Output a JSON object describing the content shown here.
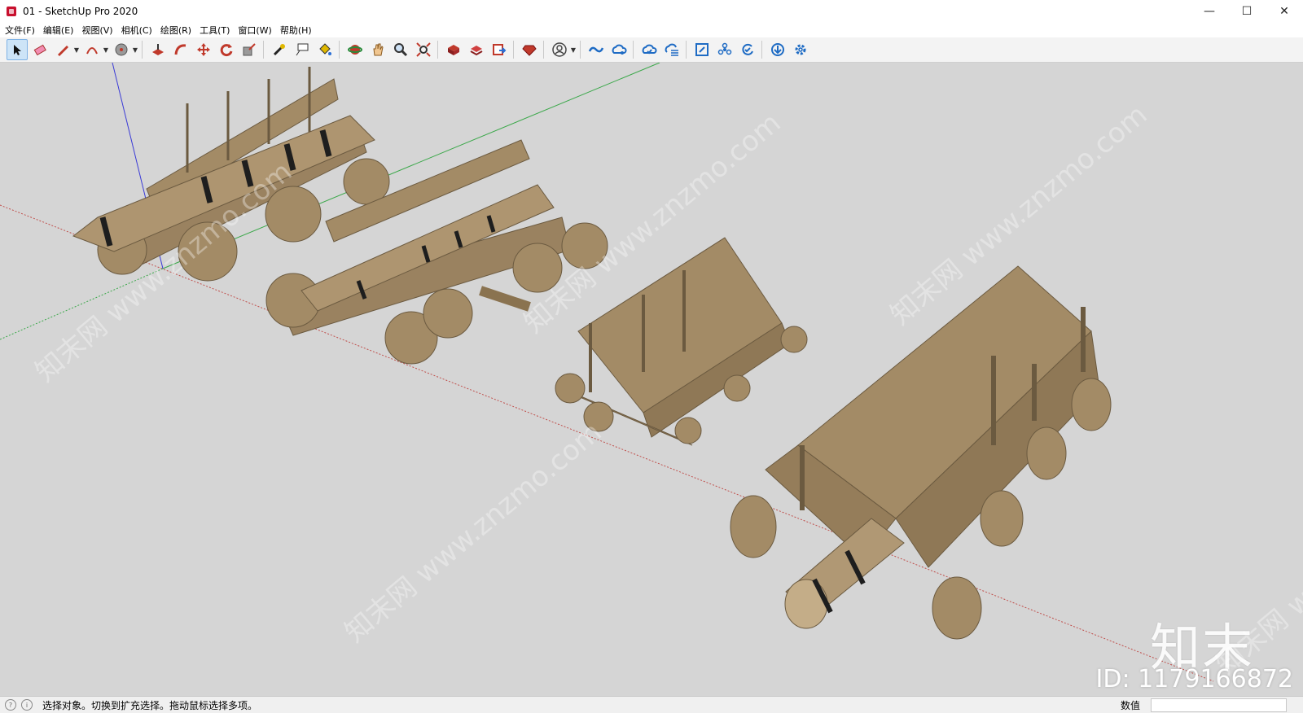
{
  "window": {
    "title": "01 - SketchUp Pro 2020",
    "minimize": "—",
    "maximize": "☐",
    "close": "✕"
  },
  "menu": [
    "文件(F)",
    "编辑(E)",
    "视图(V)",
    "相机(C)",
    "绘图(R)",
    "工具(T)",
    "窗口(W)",
    "帮助(H)"
  ],
  "toolbar": [
    {
      "icon": "select-arrow-icon",
      "active": true
    },
    {
      "icon": "eraser-icon"
    },
    {
      "icon": "pencil-line-icon",
      "dropdown": true
    },
    {
      "icon": "arc-icon",
      "dropdown": true
    },
    {
      "icon": "shape-circle-icon",
      "dropdown": true
    },
    {
      "icon": "push-pull-icon"
    },
    {
      "icon": "follow-me-icon"
    },
    {
      "icon": "move-icon"
    },
    {
      "icon": "rotate-icon"
    },
    {
      "icon": "scale-icon"
    },
    {
      "icon": "tape-measure-icon"
    },
    {
      "icon": "text-label-icon"
    },
    {
      "icon": "paint-bucket-icon"
    },
    {
      "icon": "orbit-icon"
    },
    {
      "icon": "pan-hand-icon"
    },
    {
      "icon": "zoom-icon"
    },
    {
      "icon": "zoom-extents-icon"
    },
    {
      "icon": "3d-warehouse-icon"
    },
    {
      "icon": "extension-warehouse-icon"
    },
    {
      "icon": "layout-send-icon"
    },
    {
      "icon": "ruby-console-icon"
    },
    {
      "icon": "account-icon",
      "dropdown": true
    },
    {
      "icon": "trimble-connect-icon"
    },
    {
      "icon": "cloud-share-icon"
    },
    {
      "icon": "cloud-sync-icon"
    },
    {
      "icon": "cloud-list-icon"
    },
    {
      "icon": "frame-icon"
    },
    {
      "icon": "components-icon"
    },
    {
      "icon": "refresh-check-icon"
    },
    {
      "icon": "download-icon"
    },
    {
      "icon": "settings-gear-icon"
    }
  ],
  "status": {
    "hint": "选择对象。切换到扩充选择。拖动鼠标选择多项。",
    "measurement_label": "数值",
    "measurement_value": ""
  },
  "watermark": {
    "brand": "知末",
    "id": "ID: 1179166872",
    "site": "知末网 www.znzmo.com"
  },
  "colors": {
    "wood": "#a38b66",
    "wood_dark": "#7d6a4d",
    "iron": "#222222",
    "viewport_bg": "#d5d5d5",
    "axis_red": "#c0504d",
    "axis_green": "#3ba84a",
    "axis_blue": "#3a3ad6"
  }
}
